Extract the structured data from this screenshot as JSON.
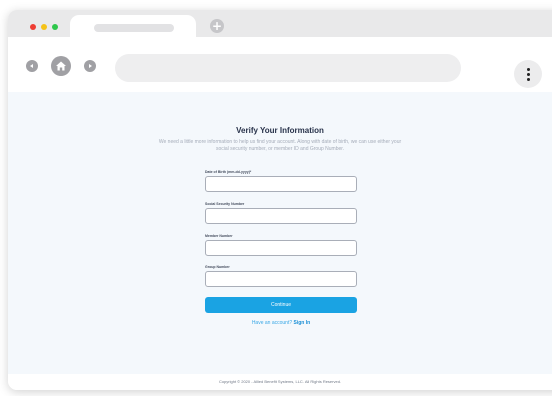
{
  "browser": {
    "new_tab_symbol": "+",
    "colors": {
      "close": "#ee3d33",
      "minimize": "#f5c218",
      "maximize": "#2ec74b"
    },
    "icons": [
      "arrow-left-icon",
      "home-icon",
      "arrow-right-icon",
      "more-vertical-icon",
      "plus-icon"
    ]
  },
  "page": {
    "title": "Verify Your Information",
    "subtitle_line1": "We need a little more information to help us find your account. Along with date of birth,",
    "subtitle_line2": "we can use either your social security number, or member ID and Group Number.",
    "fields": [
      {
        "label": "Date of Birth (mm-dd-yyyy)*",
        "value": ""
      },
      {
        "label": "Social Security Number",
        "value": ""
      },
      {
        "label": "Member Number",
        "value": ""
      },
      {
        "label": "Group Number",
        "value": ""
      }
    ],
    "continue_label": "Continue",
    "account_prompt": "Have an account?",
    "signin_label": "Sign In",
    "accent_color": "#1aa3e3"
  },
  "footer": {
    "copyright": "Copyright © 2020 - Allied Benefit Systems, LLC. All Rights Reserved."
  }
}
